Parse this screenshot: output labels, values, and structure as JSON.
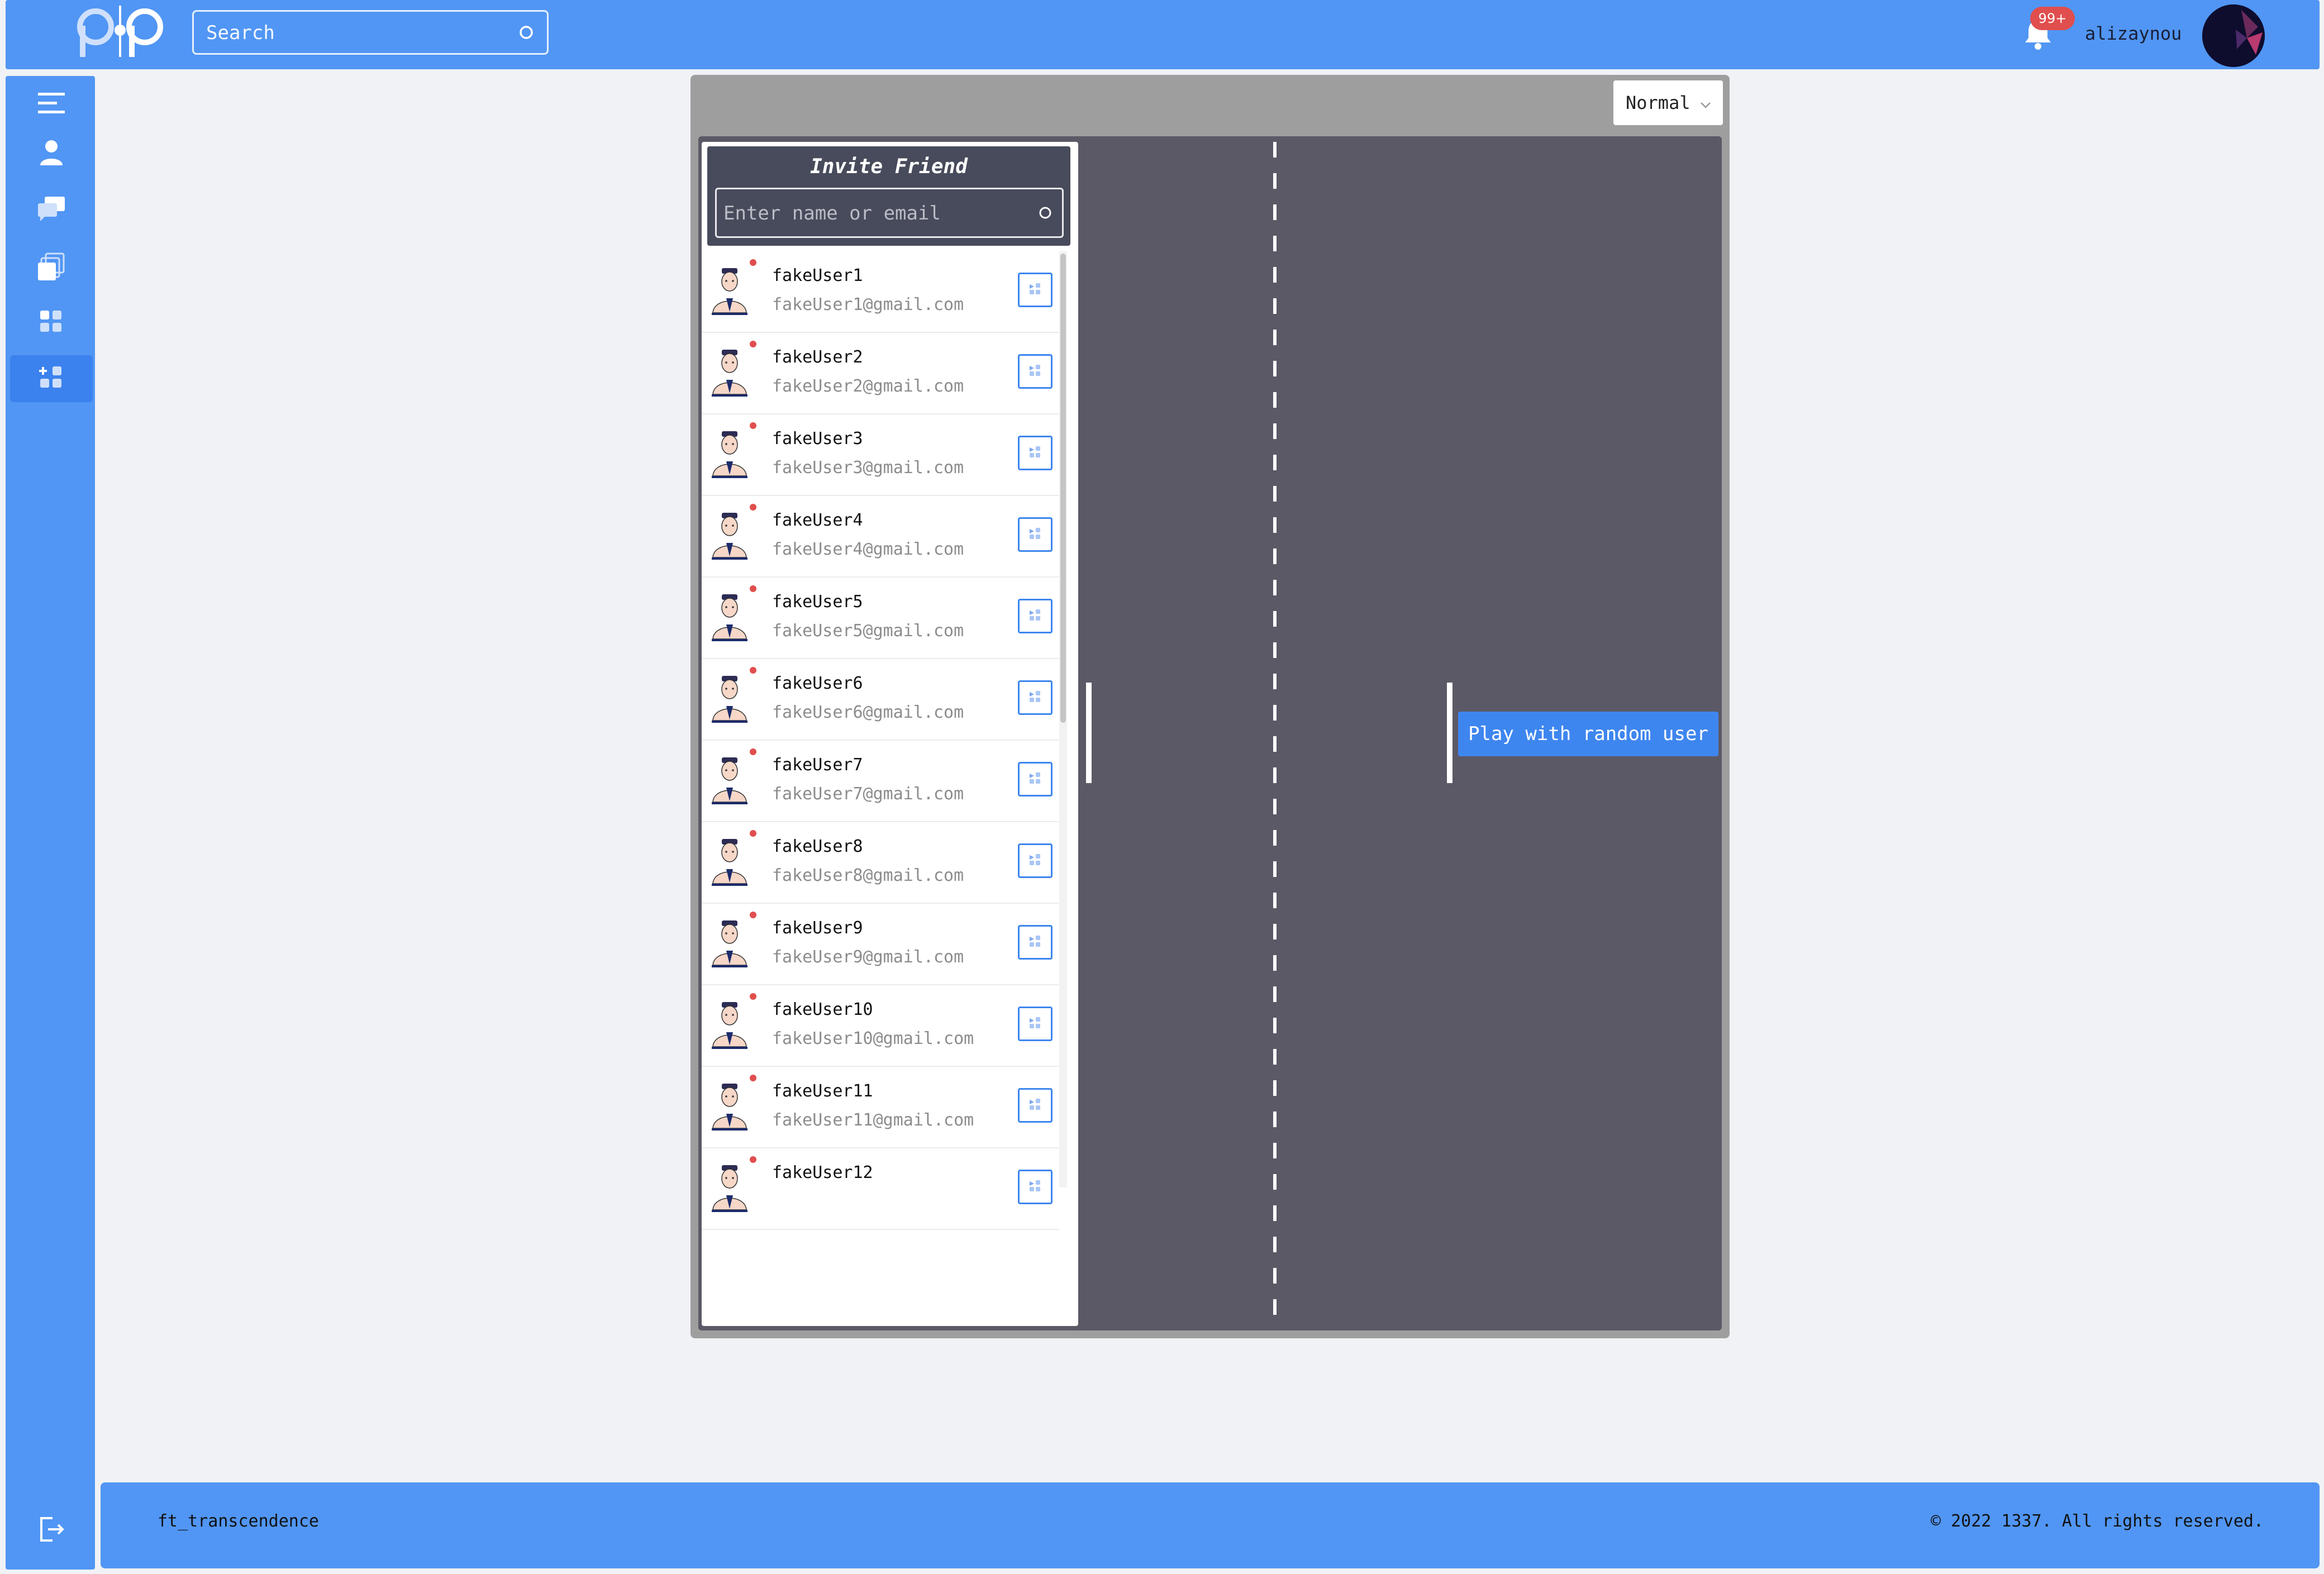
{
  "header": {
    "search_placeholder": "Search",
    "notification_badge": "99+",
    "username": "alizaynou"
  },
  "sidebar": {
    "items": [
      {
        "icon": "menu-icon"
      },
      {
        "icon": "profile-icon"
      },
      {
        "icon": "chat-icon"
      },
      {
        "icon": "pages-icon"
      },
      {
        "icon": "grid-icon"
      },
      {
        "icon": "add-game-icon",
        "active": true
      }
    ],
    "logout_icon": "logout-icon"
  },
  "game": {
    "mode_selected": "Normal",
    "play_random_label": "Play with random user"
  },
  "invite": {
    "title": "Invite Friend",
    "placeholder": "Enter name or email",
    "users": [
      {
        "name": "fakeUser1",
        "email": "fakeUser1@gmail.com"
      },
      {
        "name": "fakeUser2",
        "email": "fakeUser2@gmail.com"
      },
      {
        "name": "fakeUser3",
        "email": "fakeUser3@gmail.com"
      },
      {
        "name": "fakeUser4",
        "email": "fakeUser4@gmail.com"
      },
      {
        "name": "fakeUser5",
        "email": "fakeUser5@gmail.com"
      },
      {
        "name": "fakeUser6",
        "email": "fakeUser6@gmail.com"
      },
      {
        "name": "fakeUser7",
        "email": "fakeUser7@gmail.com"
      },
      {
        "name": "fakeUser8",
        "email": "fakeUser8@gmail.com"
      },
      {
        "name": "fakeUser9",
        "email": "fakeUser9@gmail.com"
      },
      {
        "name": "fakeUser10",
        "email": "fakeUser10@gmail.com"
      },
      {
        "name": "fakeUser11",
        "email": "fakeUser11@gmail.com"
      },
      {
        "name": "fakeUser12",
        "email": ""
      }
    ]
  },
  "footer": {
    "brand": "ft_transcendence",
    "copyright": "© 2022 1337. All rights reserved."
  },
  "colors": {
    "primary": "#5196f4",
    "court": "#5b5966",
    "button_blue": "#3e86ef",
    "badge_red": "#e14e4e"
  }
}
